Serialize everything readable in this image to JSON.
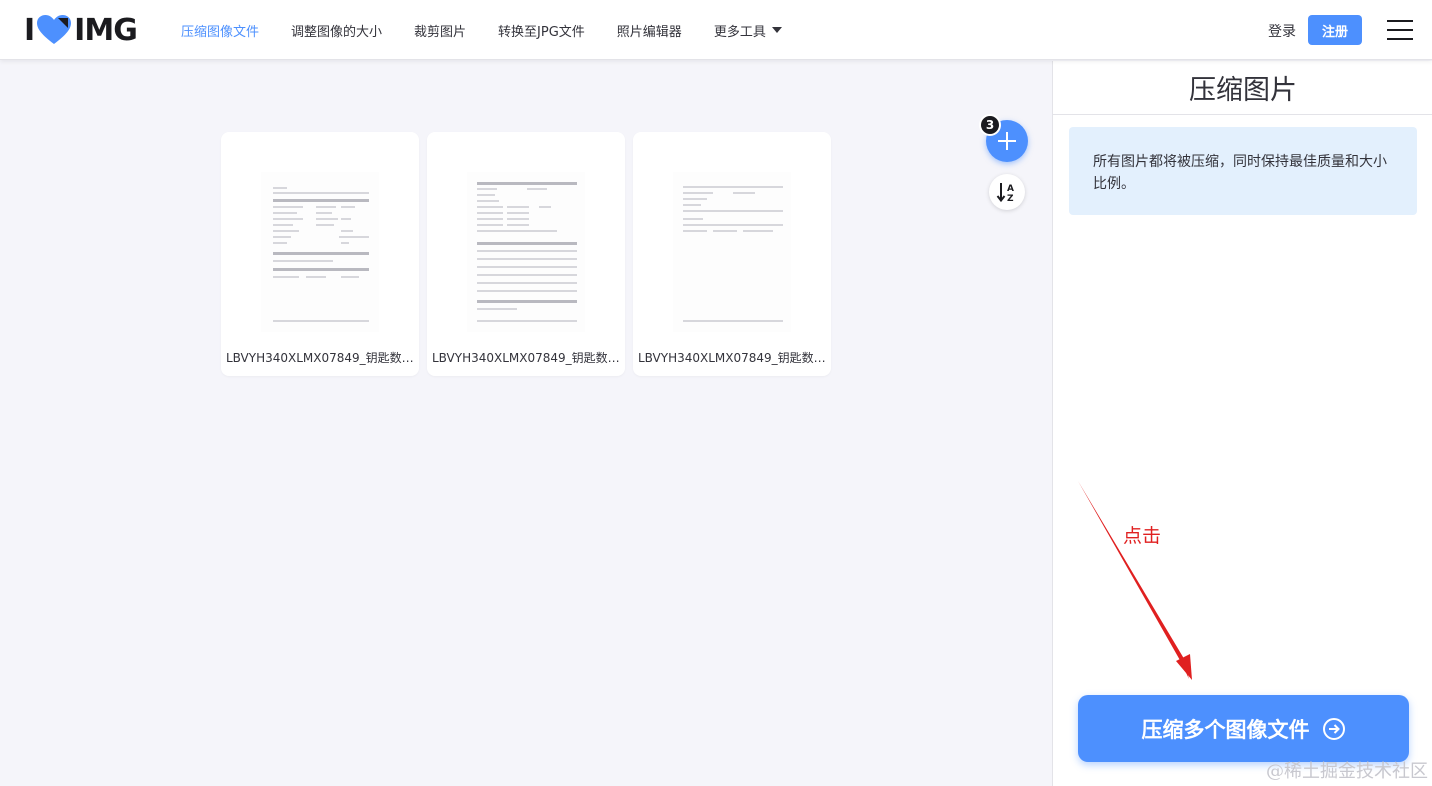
{
  "header": {
    "logo_left": "I",
    "logo_right": "IMG",
    "nav": [
      {
        "label": "压缩图像文件",
        "active": true
      },
      {
        "label": "调整图像的大小",
        "active": false
      },
      {
        "label": "裁剪图片",
        "active": false
      },
      {
        "label": "转换至JPG文件",
        "active": false
      },
      {
        "label": "照片编辑器",
        "active": false
      },
      {
        "label": "更多工具",
        "active": false
      }
    ],
    "login_label": "登录",
    "signup_label": "注册"
  },
  "workspace": {
    "file_count": "3",
    "files": [
      {
        "name": "LBVYH340XLMX07849_钥匙数据..."
      },
      {
        "name": "LBVYH340XLMX07849_钥匙数据..."
      },
      {
        "name": "LBVYH340XLMX07849_钥匙数据..."
      }
    ]
  },
  "sidebar": {
    "title": "压缩图片",
    "info_text": "所有图片都将被压缩，同时保持最佳质量和大小比例。",
    "annotation": "点击",
    "compress_label": "压缩多个图像文件"
  },
  "watermark": "@稀土掘金技术社区",
  "colors": {
    "accent": "#4d90fe",
    "info_bg": "#e3f0fd",
    "annotation_red": "#e02020"
  },
  "icons": [
    "heart-logo-icon",
    "caret-down-icon",
    "menu-icon",
    "plus-icon",
    "sort-az-icon",
    "arrow-circle-right-icon"
  ]
}
